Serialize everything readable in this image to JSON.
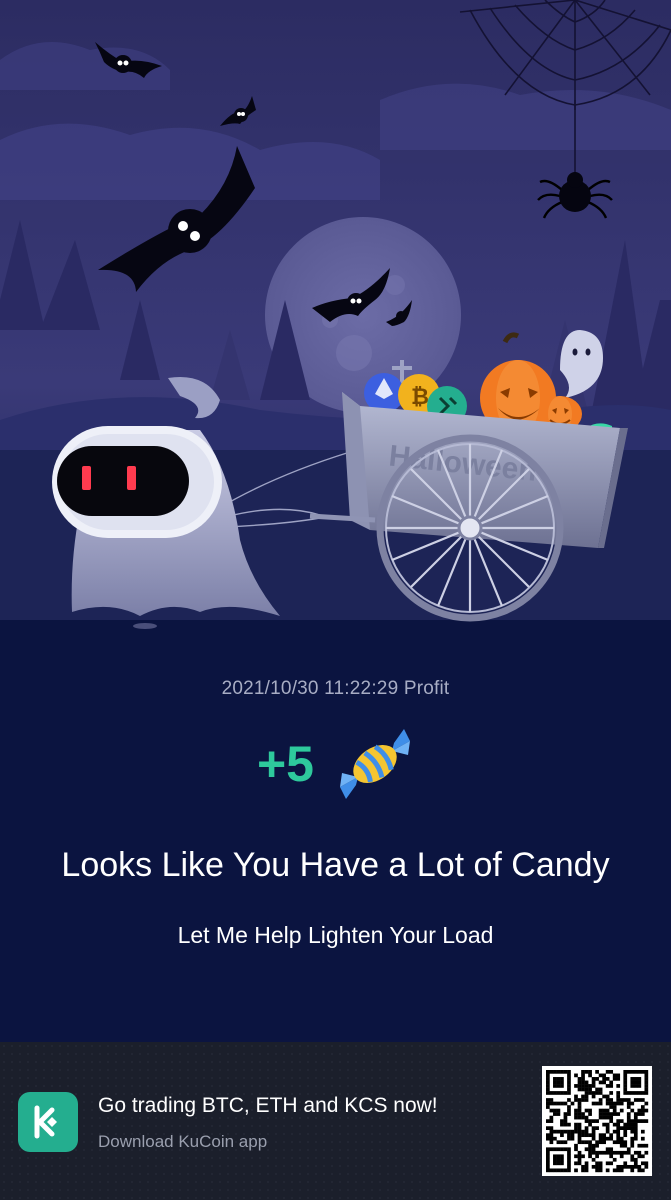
{
  "profit": {
    "timestamp": "2021/10/30 11:22:29",
    "label": "Profit",
    "amount": "+5",
    "reward_icon": "candy-icon"
  },
  "headline": "Looks Like You Have a Lot of Candy",
  "subline": "Let Me Help Lighten Your Load",
  "cart_text": "Halloween",
  "footer": {
    "title": "Go trading BTC, ETH and KCS now!",
    "subtitle": "Download KuCoin app",
    "logo_icon": "kucoin-logo-icon",
    "qr_icon": "qr-code-icon"
  },
  "colors": {
    "background": "#0b1440",
    "profit_green": "#2ec99c",
    "footer_bg": "#1b1f2b",
    "brand": "#24ae8f"
  }
}
